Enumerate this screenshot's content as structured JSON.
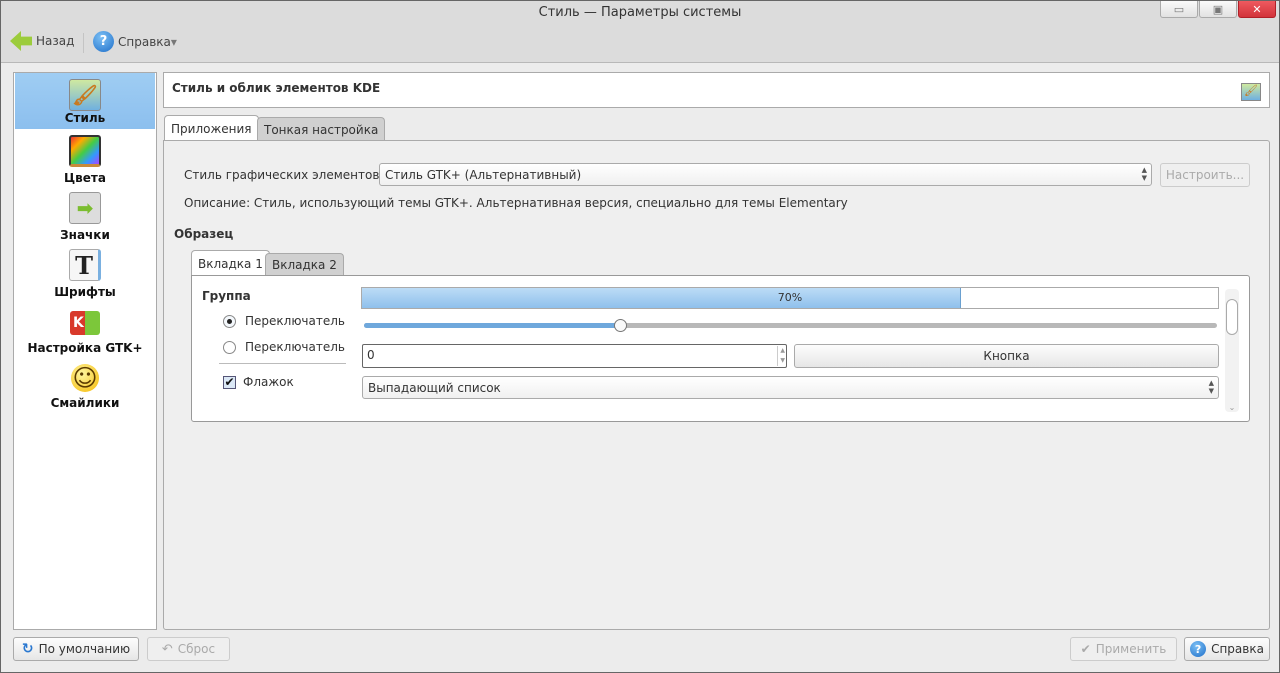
{
  "window": {
    "title": "Стиль — Параметры системы",
    "minimize": "▭",
    "maximize": "▣",
    "close": "✕"
  },
  "toolbar": {
    "back": "Назад",
    "help": "Справка",
    "help_arrow": "▾"
  },
  "sidebar": {
    "items": [
      {
        "label": "Стиль",
        "icon": "🖌",
        "selected": true
      },
      {
        "label": "Цвета",
        "icon": "🎨"
      },
      {
        "label": "Значки",
        "icon": "➡"
      },
      {
        "label": "Шрифты",
        "icon": "T"
      },
      {
        "label": "Настройка GTK+",
        "icon": "K"
      },
      {
        "label": "Смайлики",
        "icon": "☺"
      }
    ]
  },
  "header": {
    "title": "Стиль и облик элементов KDE"
  },
  "tabs": [
    {
      "label": "Приложения",
      "active": true
    },
    {
      "label": "Тонкая настройка"
    }
  ],
  "widget_style": {
    "label": "Стиль графических элементов:",
    "value": "Стиль GTK+ (Альтернативный)",
    "configure": "Настроить...",
    "description": "Описание: Стиль, использующий темы GTK+. Альтернативная версия, специально для темы Elementary"
  },
  "preview": {
    "title": "Образец",
    "tabs": [
      {
        "label": "Вкладка 1",
        "active": true
      },
      {
        "label": "Вкладка 2"
      }
    ],
    "group": "Группа",
    "radio1": "Переключатель",
    "radio2": "Переключатель",
    "checkbox": "Флажок",
    "progress": 70,
    "progress_text": "70%",
    "slider": 30,
    "spin_value": "0",
    "button": "Кнопка",
    "dropdown": "Выпадающий список"
  },
  "footer": {
    "defaults": "По умолчанию",
    "reset": "Сброс",
    "apply": "Применить",
    "help": "Справка"
  },
  "colors": {
    "accent": "#8cbfee",
    "close": "#d9363e"
  }
}
